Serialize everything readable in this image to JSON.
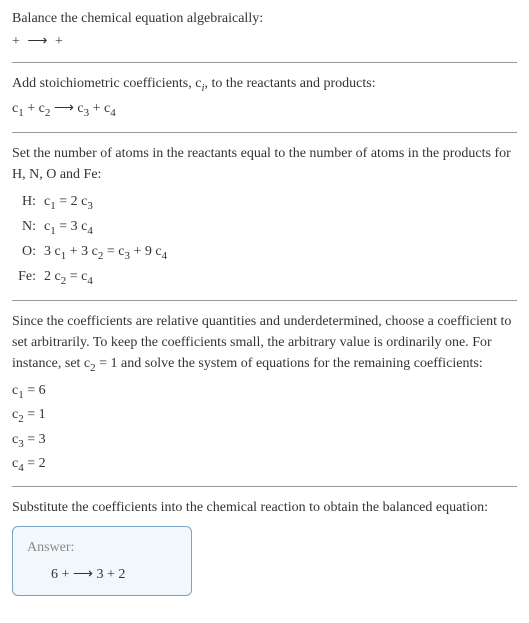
{
  "intro": {
    "line1": "Balance the chemical equation algebraically:",
    "line2_a": " + ",
    "line2_arrow": "⟶",
    "line2_b": " + "
  },
  "step1": {
    "text": "Add stoichiometric coefficients, ",
    "ci": "c",
    "ci_sub": "i",
    "text2": ", to the reactants and products:",
    "eq": {
      "c1": "c",
      "s1": "1",
      "plus1": " + ",
      "c2": "c",
      "s2": "2",
      "arrow": " ⟶ ",
      "c3": "c",
      "s3": "3",
      "plus2": " + ",
      "c4": "c",
      "s4": "4"
    }
  },
  "step2": {
    "text": "Set the number of atoms in the reactants equal to the number of atoms in the products for H, N, O and Fe:",
    "rows": {
      "h_label": "H:",
      "h_eq_a": "c",
      "h_eq_as": "1",
      "h_eq_mid": " = 2 ",
      "h_eq_b": "c",
      "h_eq_bs": "3",
      "n_label": "N:",
      "n_eq_a": "c",
      "n_eq_as": "1",
      "n_eq_mid": " = 3 ",
      "n_eq_b": "c",
      "n_eq_bs": "4",
      "o_label": "O:",
      "o_eq_a": "3 ",
      "o_eq_b": "c",
      "o_eq_bs": "1",
      "o_eq_c": " + 3 ",
      "o_eq_d": "c",
      "o_eq_ds": "2",
      "o_eq_e": " = ",
      "o_eq_f": "c",
      "o_eq_fs": "3",
      "o_eq_g": " + 9 ",
      "o_eq_h": "c",
      "o_eq_hs": "4",
      "fe_label": "Fe:",
      "fe_eq_a": "2 ",
      "fe_eq_b": "c",
      "fe_eq_bs": "2",
      "fe_eq_c": " = ",
      "fe_eq_d": "c",
      "fe_eq_ds": "4"
    }
  },
  "step3": {
    "text_a": "Since the coefficients are relative quantities and underdetermined, choose a coefficient to set arbitrarily. To keep the coefficients small, the arbitrary value is ordinarily one. For instance, set ",
    "c2": "c",
    "c2s": "2",
    "text_b": " = 1 and solve the system of equations for the remaining coefficients:",
    "coefs": {
      "l1a": "c",
      "l1s": "1",
      "l1b": " = 6",
      "l2a": "c",
      "l2s": "2",
      "l2b": " = 1",
      "l3a": "c",
      "l3s": "3",
      "l3b": " = 3",
      "l4a": "c",
      "l4s": "4",
      "l4b": " = 2"
    }
  },
  "step4": {
    "text": "Substitute the coefficients into the chemical reaction to obtain the balanced equation:"
  },
  "answer": {
    "label": "Answer:",
    "eq": "6  +  ⟶ 3  + 2"
  }
}
